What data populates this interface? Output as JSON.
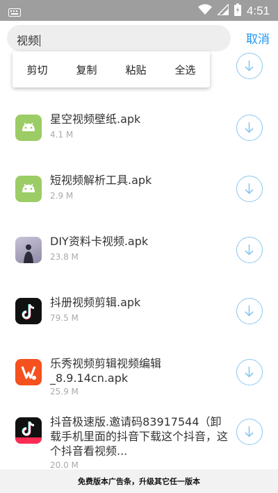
{
  "status": {
    "time": "4:51"
  },
  "search": {
    "query": "视频",
    "cancel_label": "取消"
  },
  "context_menu": {
    "cut": "剪切",
    "copy": "复制",
    "paste": "粘贴",
    "select_all": "全选"
  },
  "items": [
    {
      "title": "星空视频壁纸.apk",
      "size": "4.1 M",
      "icon": "android-icon"
    },
    {
      "title": "短视频解析工具.apk",
      "size": "2.9 M",
      "icon": "android-icon"
    },
    {
      "title": "DIY资料卡视频.apk",
      "size": "23.8 M",
      "icon": "photo-icon"
    },
    {
      "title": "抖册视频剪辑.apk",
      "size": "79.5 M",
      "icon": "tiktok-icon"
    },
    {
      "title": "乐秀视频剪辑视频编辑_8.9.14cn.apk",
      "size": "25.9 M",
      "icon": "videoshow-icon"
    },
    {
      "title": "抖音极速版.邀请码83917544（卸载手机里面的抖音下载这个抖音，这个抖音看视频...",
      "size": "20.0 M",
      "icon": "tiktok-lite-icon"
    }
  ],
  "ad": {
    "text": "免费版本广告条，升级其它任一版本"
  },
  "colors": {
    "accent": "#2196f3",
    "android_green": "#9ccc65",
    "tiktok_bg": "#111111",
    "videoshow_bg": "#f4511e"
  }
}
